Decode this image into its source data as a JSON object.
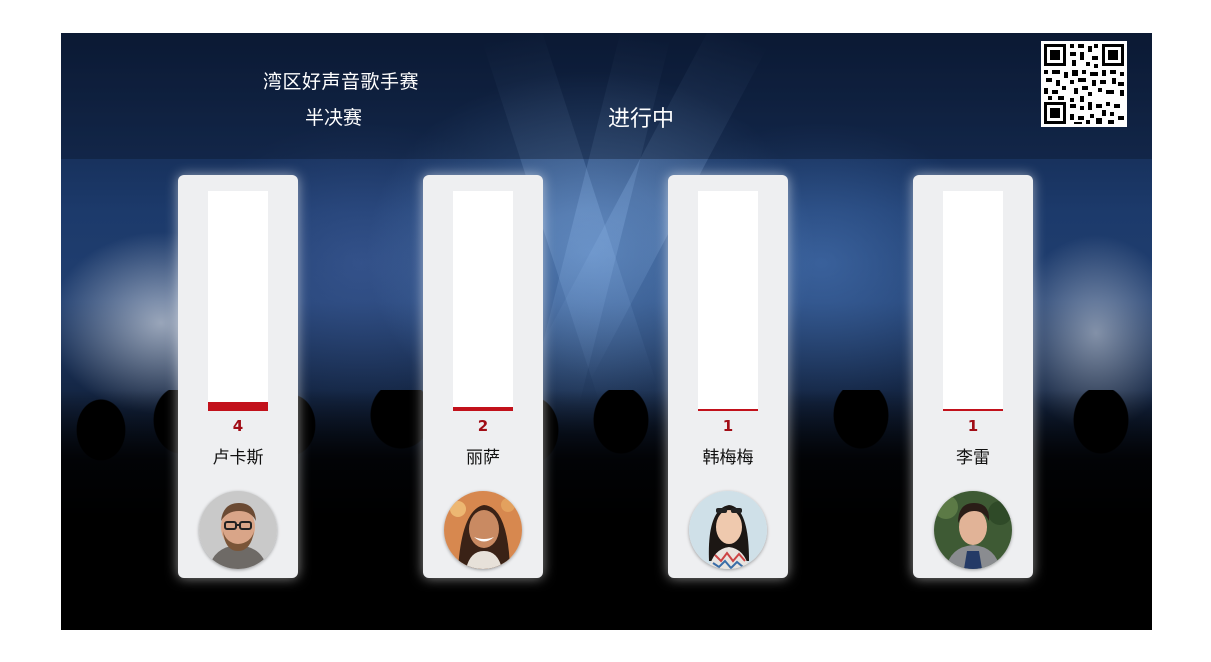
{
  "event": {
    "title": "湾区好声音歌手赛",
    "stage": "半决赛",
    "status": "进行中"
  },
  "qr_icon": "qr-code-icon",
  "accent_color": "#c2111b",
  "max_votes": 100,
  "contestants": [
    {
      "name": "卢卡斯",
      "votes": "4",
      "vote_value": 4,
      "avatar": "man-glasses-avatar"
    },
    {
      "name": "丽萨",
      "votes": "2",
      "vote_value": 2,
      "avatar": "woman-smiling-avatar"
    },
    {
      "name": "韩梅梅",
      "votes": "1",
      "vote_value": 1,
      "avatar": "woman-sunglasses-avatar"
    },
    {
      "name": "李雷",
      "votes": "1",
      "vote_value": 1,
      "avatar": "young-man-avatar"
    }
  ]
}
